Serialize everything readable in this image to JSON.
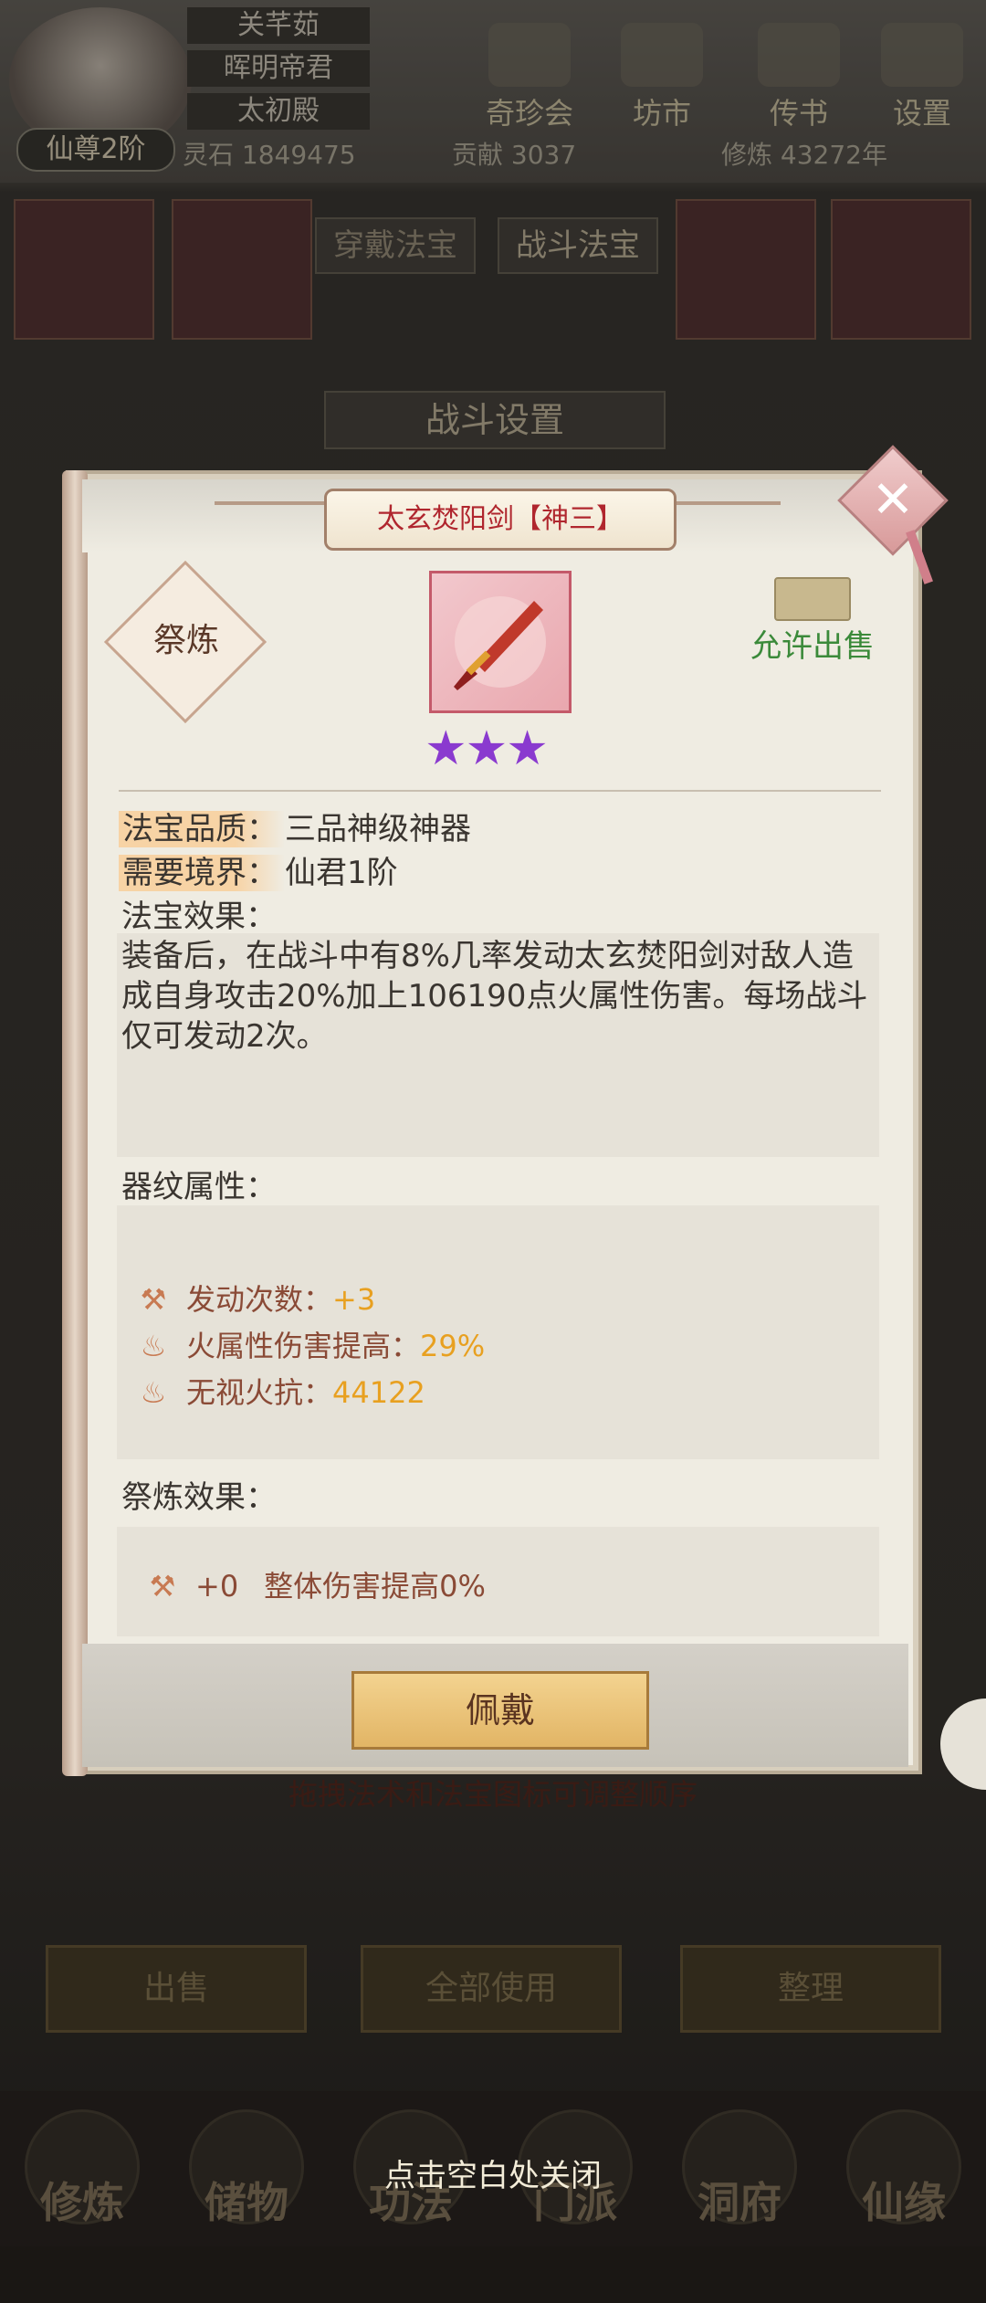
{
  "background": {
    "player": {
      "rank": "仙尊2阶",
      "names": [
        "关芊茹",
        "晖明帝君",
        "太初殿"
      ]
    },
    "top_nav": [
      "奇珍会",
      "坊市",
      "传书",
      "设置"
    ],
    "resources": {
      "lingshi": "灵石 1849475",
      "gongxian": "贡献 3037",
      "xiulian": "修炼 43272年"
    },
    "tabs": [
      "穿戴法宝",
      "战斗法宝"
    ],
    "battle_settings_title": "战斗设置",
    "drag_hint": "拖拽法术和法宝图标可调整顺序",
    "actions": {
      "sell": "出售",
      "use_all": "全部使用",
      "sort": "整理"
    },
    "bottom_nav": [
      "修炼",
      "储物",
      "功法",
      "门派",
      "洞府",
      "仙缘"
    ],
    "close_hint": "点击空白处关闭"
  },
  "modal": {
    "title": "太玄焚阳剑【神三】",
    "jilian_label": "祭炼",
    "sell_status": "允许出售",
    "stars": "★★★",
    "quality_label": "法宝品质：",
    "quality_value": "三品神级神器",
    "realm_label": "需要境界：",
    "realm_value": "仙君1阶",
    "effect_label": "法宝效果：",
    "effect_text": "装备后，在战斗中有8%几率发动太玄焚阳剑对敌人造成自身攻击20%加上106190点火属性伤害。每场战斗仅可发动2次。",
    "qiwen_label": "器纹属性：",
    "qiwen_attrs": [
      {
        "label": "发动次数：",
        "value": "+3",
        "icon": "hammer-icon"
      },
      {
        "label": "火属性伤害提高：",
        "value": "29%",
        "icon": "fire-icon"
      },
      {
        "label": "无视火抗：",
        "value": "44122",
        "icon": "fire-icon"
      }
    ],
    "jilian_effect_label": "祭炼效果：",
    "jilian_effect": {
      "value": "+0",
      "text": "整体伤害提高0%"
    },
    "wear_button": "佩戴"
  },
  "colors": {
    "title_red": "#b0262e",
    "sell_green": "#3b8a3a",
    "value_orange": "#e8a020",
    "star_purple": "#8a3acf"
  }
}
